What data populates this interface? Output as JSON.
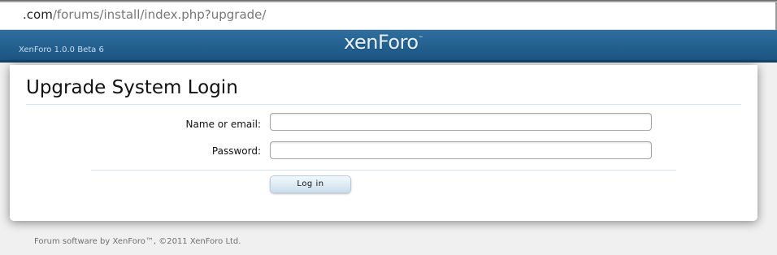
{
  "browser": {
    "url_domain": ".com",
    "url_path": "/forums/install/index.php?upgrade/"
  },
  "header": {
    "version": "XenForo 1.0.0 Beta 6",
    "logo_text": "xenForo",
    "logo_tm": "™"
  },
  "panel": {
    "title": "Upgrade System Login",
    "name_label": "Name or email:",
    "name_value": "",
    "password_label": "Password:",
    "password_value": "",
    "login_button": "Log in"
  },
  "footer": {
    "text": "Forum software by XenForo™, ©2011 XenForo Ltd."
  },
  "colors": {
    "header_bg": "#1b5582",
    "button_bg": "#cbdeec",
    "page_bg": "#f0f0f0"
  }
}
